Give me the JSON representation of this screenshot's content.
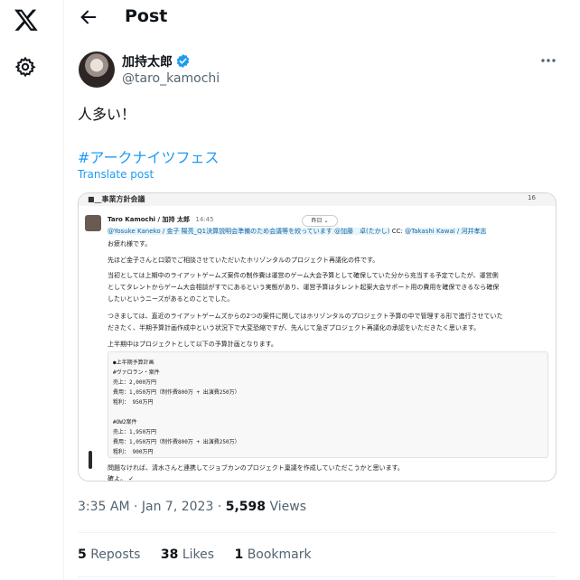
{
  "header": {
    "title": "Post"
  },
  "author": {
    "name": "加持太郎",
    "handle": "@taro_kamochi"
  },
  "post": {
    "text": "人多い！",
    "hashtag": "#アークナイツフェス",
    "translate_label": "Translate post"
  },
  "embedded_image": {
    "channel_title": "■__事業方針会議",
    "member_count": "16",
    "sender": "Taro Kamochi / 加持 太郎",
    "time": "14:45",
    "day_label": "昨日 ⌄",
    "mention_line": "@Yosuke Kaneko / 金子 陽亮_Q1決算説明会準備のため会議等を絞っています @加藤　卓(たかし)",
    "cc_label": "CC:",
    "cc_mentions": "@Takashi Kawai / 河井孝志",
    "greeting": "お疲れ様です。",
    "para1": "先ほど金子さんと口頭でご相談させていただいたホリゾンタルのプロジェクト再議化の件です。",
    "para2a": "当初としては上期中のライアットゲームズ案件の制作費は運営のゲーム大会予算として確保していた分から充当する予定でしたが、運営側",
    "para2b": "としてタレントからゲーム大会相談がすでにあるという実態があり、運営予算はタレント起案大会サポート用の費用を確保できるなら確保",
    "para2c": "したいというニーズがあるとのことでした。",
    "para3a": "つきましては、直近のライアットゲームズからの2つの案件に関してはホリゾンタルのプロジェクト予算の中で管理する形で進行させていた",
    "para3b": "だきたく、半期予算計画作成中という状況下で大変恐縮ですが、先んじて急ぎプロジェクト再議化の承認をいただきたく思います。",
    "para4": "上半期中はプロジェクトとして以下の予算計画となります。",
    "code_lines": [
      "●上半期予算計画",
      "#ヴァロラン・案件",
      "売上：2,000万円",
      "費用：1,050万円（制作費800万 + 出演費250万）",
      "粗利： 950万円",
      "",
      "#OW2案件",
      "売上：1,950万円",
      "費用：1,050万円（制作費800万 + 出演費250万）",
      "粗利： 900万円"
    ],
    "closing": "問題なければ、清水さんと連携してジョブカンのプロジェクト稟議を作成していただこうかと思います。",
    "trailing": "確よ。 ✓"
  },
  "meta": {
    "time": "3:35 AM · Jan 7, 2023",
    "separator": " · ",
    "views_count": "5,598",
    "views_label": " Views"
  },
  "stats": {
    "reposts_count": "5",
    "reposts_label": " Reposts",
    "likes_count": "38",
    "likes_label": " Likes",
    "bookmarks_count": "1",
    "bookmarks_label": " Bookmark"
  },
  "colors": {
    "accent": "#1d9bf0",
    "text": "#0f1419",
    "muted": "#536471",
    "border": "#eff3f4"
  },
  "icons": {
    "logo": "x-logo-icon",
    "settings": "gear-icon",
    "back": "back-arrow-icon",
    "verified": "verified-badge-icon",
    "more": "more-dots-icon"
  }
}
